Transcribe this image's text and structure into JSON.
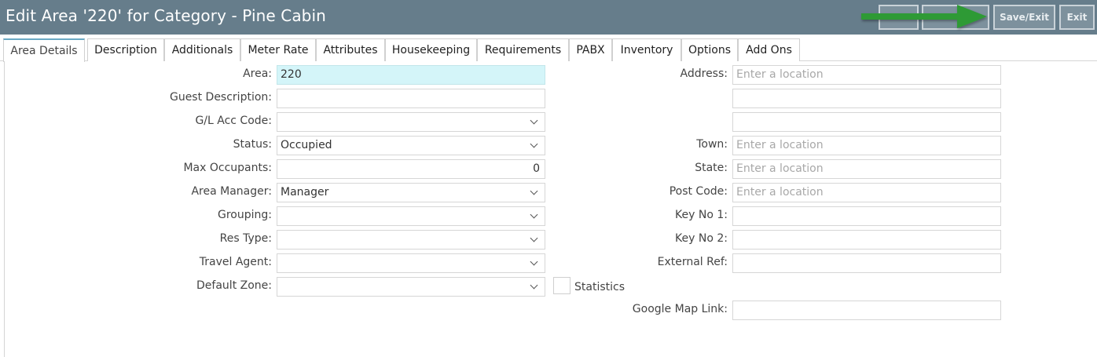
{
  "header": {
    "title": "Edit Area '220' for Category - Pine Cabin",
    "buttons": [
      "",
      "",
      "Save/Exit",
      "Exit"
    ]
  },
  "tabs": [
    "Area Details",
    "Description",
    "Additionals",
    "Meter Rate",
    "Attributes",
    "Housekeeping",
    "Requirements",
    "PABX",
    "Inventory",
    "Options",
    "Add Ons"
  ],
  "left_form": {
    "area_label": "Area:",
    "area_value": "220",
    "guest_desc_label": "Guest Description:",
    "guest_desc_value": "",
    "gl_label": "G/L Acc Code:",
    "gl_value": "",
    "status_label": "Status:",
    "status_value": "Occupied",
    "max_occ_label": "Max Occupants:",
    "max_occ_value": "0",
    "area_mgr_label": "Area Manager:",
    "area_mgr_value": "Manager",
    "grouping_label": "Grouping:",
    "grouping_value": "",
    "res_type_label": "Res Type:",
    "res_type_value": "",
    "travel_agent_label": "Travel Agent:",
    "travel_agent_value": "",
    "default_zone_label": "Default Zone:",
    "default_zone_value": "",
    "statistics_label": "Statistics"
  },
  "right_form": {
    "address_label": "Address:",
    "address_placeholder": "Enter a location",
    "town_label": "Town:",
    "town_placeholder": "Enter a location",
    "state_label": "State:",
    "state_placeholder": "Enter a location",
    "postcode_label": "Post Code:",
    "postcode_placeholder": "Enter a location",
    "key1_label": "Key No 1:",
    "key2_label": "Key No 2:",
    "extref_label": "External Ref:",
    "gmap_label": "Google Map Link:"
  },
  "colors": {
    "header_bg": "#667d8b",
    "highlight": "#d4f5f9",
    "arrow": "#2e9a36",
    "active_tab_border": "#6aa9c4"
  }
}
